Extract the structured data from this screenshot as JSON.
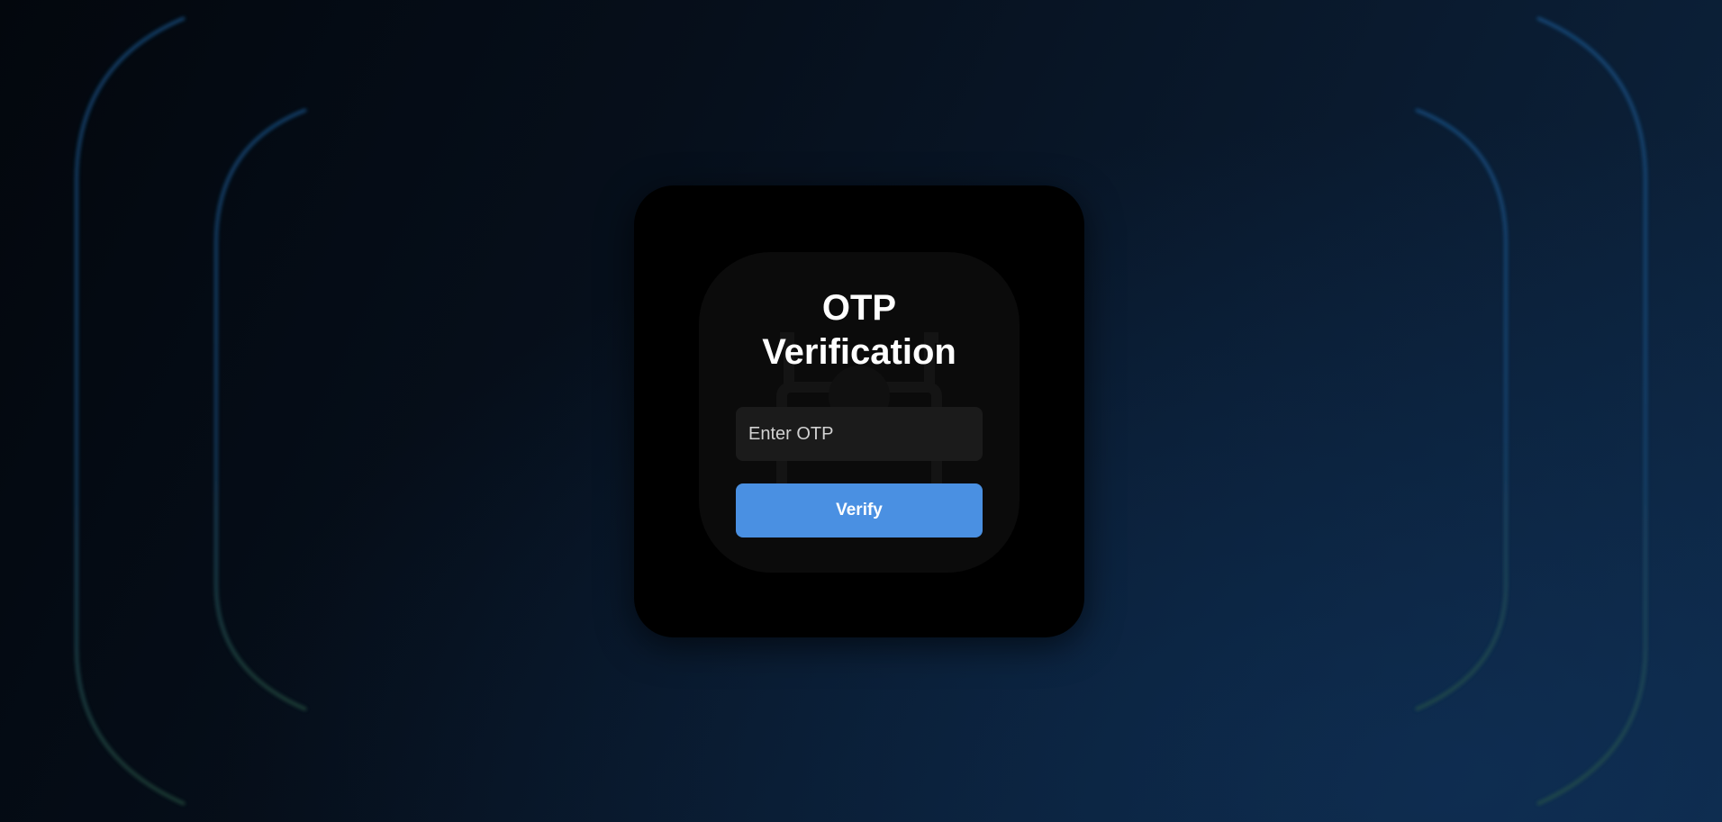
{
  "heading": {
    "line1": "OTP",
    "line2": "Verification"
  },
  "otp_input": {
    "placeholder": "Enter OTP",
    "value": ""
  },
  "verify_button": {
    "label": "Verify"
  },
  "colors": {
    "accent": "#4a90e2",
    "card": "#000000",
    "input_background": "#1b1b1b"
  },
  "icons": [
    "lock-icon"
  ]
}
